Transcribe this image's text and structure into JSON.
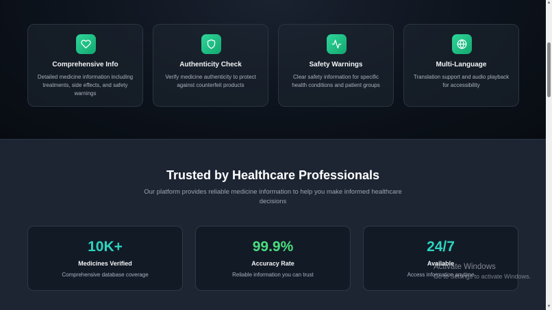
{
  "features": [
    {
      "icon": "heart-icon",
      "title": "Comprehensive Info",
      "description": "Detailed medicine information including treatments, side effects, and safety warnings"
    },
    {
      "icon": "shield-icon",
      "title": "Authenticity Check",
      "description": "Verify medicine authenticity to protect against counterfeit products"
    },
    {
      "icon": "activity-icon",
      "title": "Safety Warnings",
      "description": "Clear safety information for specific health conditions and patient groups"
    },
    {
      "icon": "globe-icon",
      "title": "Multi-Language",
      "description": "Translation support and audio playback for accessibility"
    }
  ],
  "trusted": {
    "title": "Trusted by Healthcare Professionals",
    "subtitle": "Our platform provides reliable medicine information to help you make informed healthcare decisions"
  },
  "stats": [
    {
      "value": "10K+",
      "label": "Medicines Verified",
      "description": "Comprehensive database coverage",
      "color": "#2dd4bf"
    },
    {
      "value": "99.9%",
      "label": "Accuracy Rate",
      "description": "Reliable information you can trust",
      "color": "#4ade80"
    },
    {
      "value": "24/7",
      "label": "Available",
      "description": "Access information anytime",
      "color": "#2dd4bf"
    }
  ],
  "watermark": {
    "title": "Activate Windows",
    "subtitle": "Go to Settings to activate Windows."
  },
  "colors": {
    "accent_green": "#22c55e",
    "accent_teal": "#2dd4bf",
    "background_dark": "#0a0f17",
    "section_bg": "#1d2533"
  }
}
